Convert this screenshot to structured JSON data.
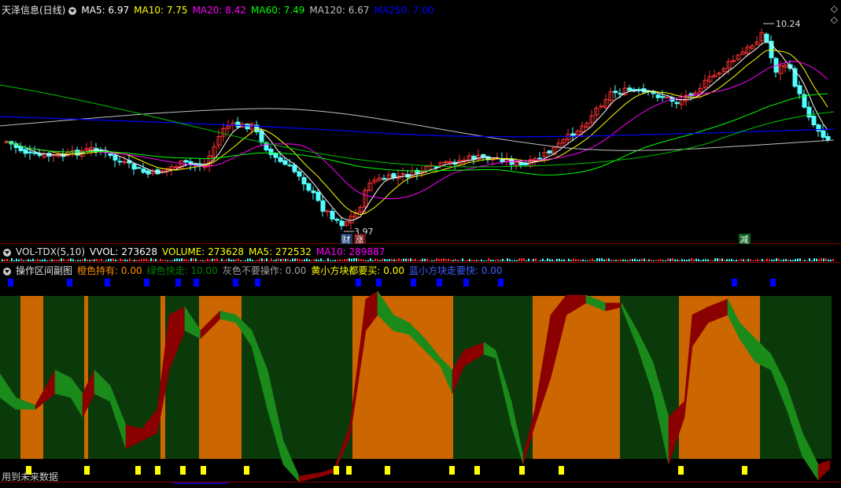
{
  "main_panel": {
    "title": "天泽信息(日线)",
    "indicators": [
      {
        "label": "MA5: 6.97",
        "color": "#ffffff"
      },
      {
        "label": "MA10: 7.75",
        "color": "#ffff00"
      },
      {
        "label": "MA20: 8.42",
        "color": "#ff00ff"
      },
      {
        "label": "MA60: 7.49",
        "color": "#00ff00"
      },
      {
        "label": "MA120: 6.67",
        "color": "#c0c0c0"
      },
      {
        "label": "MA250: 7.00",
        "color": "#0000ff"
      }
    ],
    "high_label": "10.24",
    "low_label": "3.97",
    "badges": [
      {
        "text": "财",
        "bg": "#1f3f6f"
      },
      {
        "text": "涨",
        "bg": "#6f1010"
      },
      {
        "text": "减",
        "bg": "#105f20"
      }
    ],
    "corner_icons": [
      "◇",
      "◇"
    ]
  },
  "vol_panel": {
    "title": "VOL-TDX(5,10)",
    "items": [
      {
        "label": "VVOL: 273628",
        "color": "#ffffff"
      },
      {
        "label": "VOLUME: 273628",
        "color": "#ffff00"
      },
      {
        "label": "MA5: 272532",
        "color": "#ffff00"
      },
      {
        "label": "MA10: 289887",
        "color": "#ff00ff"
      }
    ]
  },
  "sub_panel": {
    "title": "操作区间副图",
    "items": [
      {
        "label": "橙色持有: 0.00",
        "color": "#ff8c00"
      },
      {
        "label": "绿色快走: 10.00",
        "color": "#008000"
      },
      {
        "label": "灰色不要操作: 0.00",
        "color": "#a0a0a0"
      },
      {
        "label": "黄小方块都要买: 0.00",
        "color": "#ffff00"
      },
      {
        "label": "蓝小方块走要快: 0.00",
        "color": "#4060ff"
      }
    ]
  },
  "footer": {
    "text": "用到未来数据"
  },
  "colors": {
    "candle_up": "#ff3232",
    "candle_down": "#54ffff",
    "orange_zone": "#cc6600",
    "green_zone": "#0a3a0a",
    "wave_red": "#8b0000",
    "wave_green": "#1a8a1a",
    "blue_marker": "#0000ff",
    "yellow_marker": "#ffff00"
  }
}
